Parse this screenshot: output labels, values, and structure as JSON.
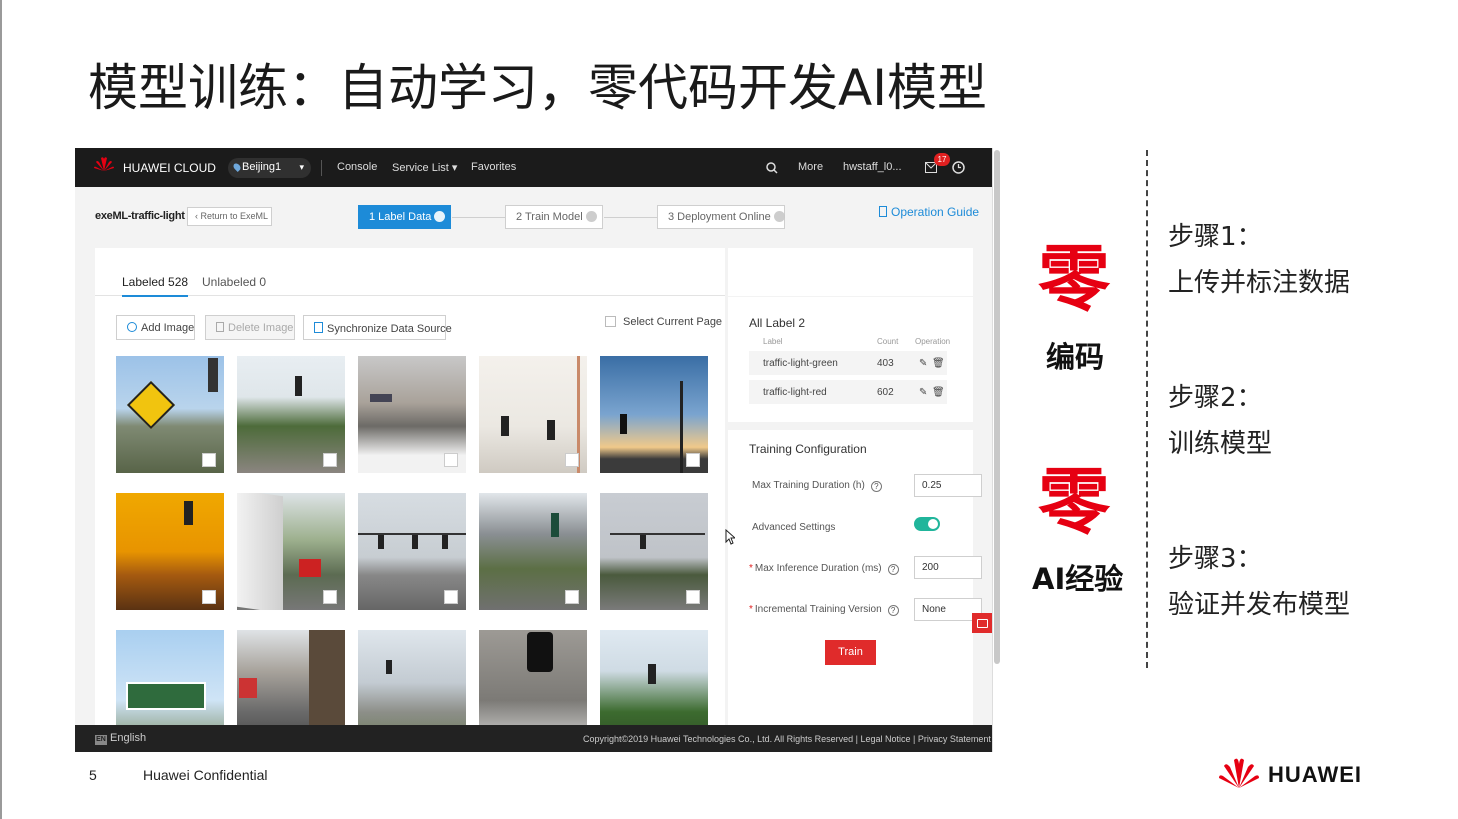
{
  "slide": {
    "title": "模型训练：自动学习，零代码开发AI模型",
    "page_number": "5",
    "confidential": "Huawei Confidential",
    "brand": "HUAWEI",
    "accent_color": "#e60012"
  },
  "zero_badges": [
    {
      "big": "零",
      "caption": "编码"
    },
    {
      "big": "零",
      "caption": "AI经验"
    }
  ],
  "steps": [
    {
      "title": "步骤1：",
      "desc": "上传并标注数据"
    },
    {
      "title": "步骤2：",
      "desc": "训练模型"
    },
    {
      "title": "步骤3：",
      "desc": "验证并发布模型"
    }
  ],
  "console": {
    "topnav": {
      "brand": "HUAWEI CLOUD",
      "region": "Beijing1",
      "console": "Console",
      "service_list": "Service List ▾",
      "favorites": "Favorites",
      "more": "More",
      "user": "hwstaff_l0...",
      "notification_count": "17"
    },
    "project": "exeML-traffic-light",
    "return_label": "Return to ExeML",
    "workflow": [
      "1 Label Data",
      "2 Train Model",
      "3 Deployment Online"
    ],
    "operation_guide": "Operation Guide",
    "tabs": [
      "Labeled 528",
      "Unlabeled 0"
    ],
    "actions": {
      "add": "Add Image",
      "delete": "Delete Image",
      "sync": "Synchronize Data Source",
      "select_page": "Select Current Page"
    },
    "labels": {
      "heading": "All Label  2",
      "columns": [
        "Label",
        "Count",
        "Operation"
      ],
      "rows": [
        {
          "label": "traffic-light-green",
          "count": "403"
        },
        {
          "label": "traffic-light-red",
          "count": "602"
        }
      ]
    },
    "training": {
      "heading": "Training Configuration",
      "max_duration_label": "Max Training Duration (h)",
      "max_duration_value": "0.25",
      "advanced_label": "Advanced Settings",
      "advanced_enabled": true,
      "inference_label": "Max Inference Duration (ms)",
      "inference_value": "200",
      "incremental_label": "Incremental Training Version",
      "incremental_value": "None",
      "train_button": "Train"
    },
    "footer": {
      "language": "English",
      "copyright": "Copyright©2019 Huawei Technologies Co., Ltd. All Rights Reserved  |  Legal Notice  |  Privacy Statement"
    }
  }
}
